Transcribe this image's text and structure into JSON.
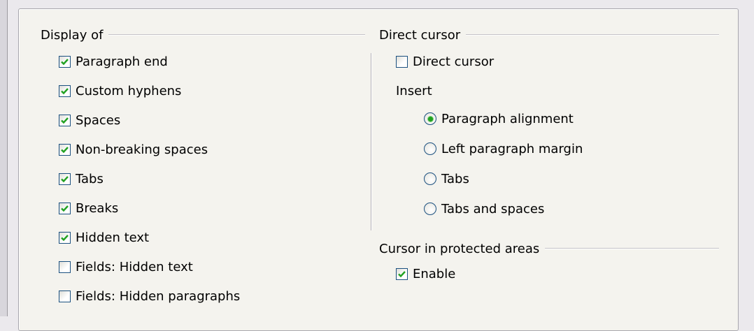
{
  "display_of": {
    "title": "Display of",
    "items": [
      {
        "label": "Paragraph end",
        "checked": true
      },
      {
        "label": "Custom hyphens",
        "checked": true
      },
      {
        "label": "Spaces",
        "checked": true
      },
      {
        "label": "Non-breaking spaces",
        "checked": true
      },
      {
        "label": "Tabs",
        "checked": true
      },
      {
        "label": "Breaks",
        "checked": true
      },
      {
        "label": "Hidden text",
        "checked": true
      },
      {
        "label": "Fields: Hidden text",
        "checked": false
      },
      {
        "label": "Fields: Hidden paragraphs",
        "checked": false
      }
    ]
  },
  "direct_cursor": {
    "title": "Direct cursor",
    "checkbox": {
      "label": "Direct cursor",
      "checked": false
    },
    "insert_label": "Insert",
    "options": [
      {
        "label": "Paragraph alignment",
        "selected": true
      },
      {
        "label": "Left paragraph margin",
        "selected": false
      },
      {
        "label": "Tabs",
        "selected": false
      },
      {
        "label": "Tabs and spaces",
        "selected": false
      }
    ]
  },
  "protected": {
    "title": "Cursor in protected areas",
    "checkbox": {
      "label": "Enable",
      "checked": true
    }
  },
  "colors": {
    "check": "#21a121",
    "box_border": "#1c5180"
  }
}
